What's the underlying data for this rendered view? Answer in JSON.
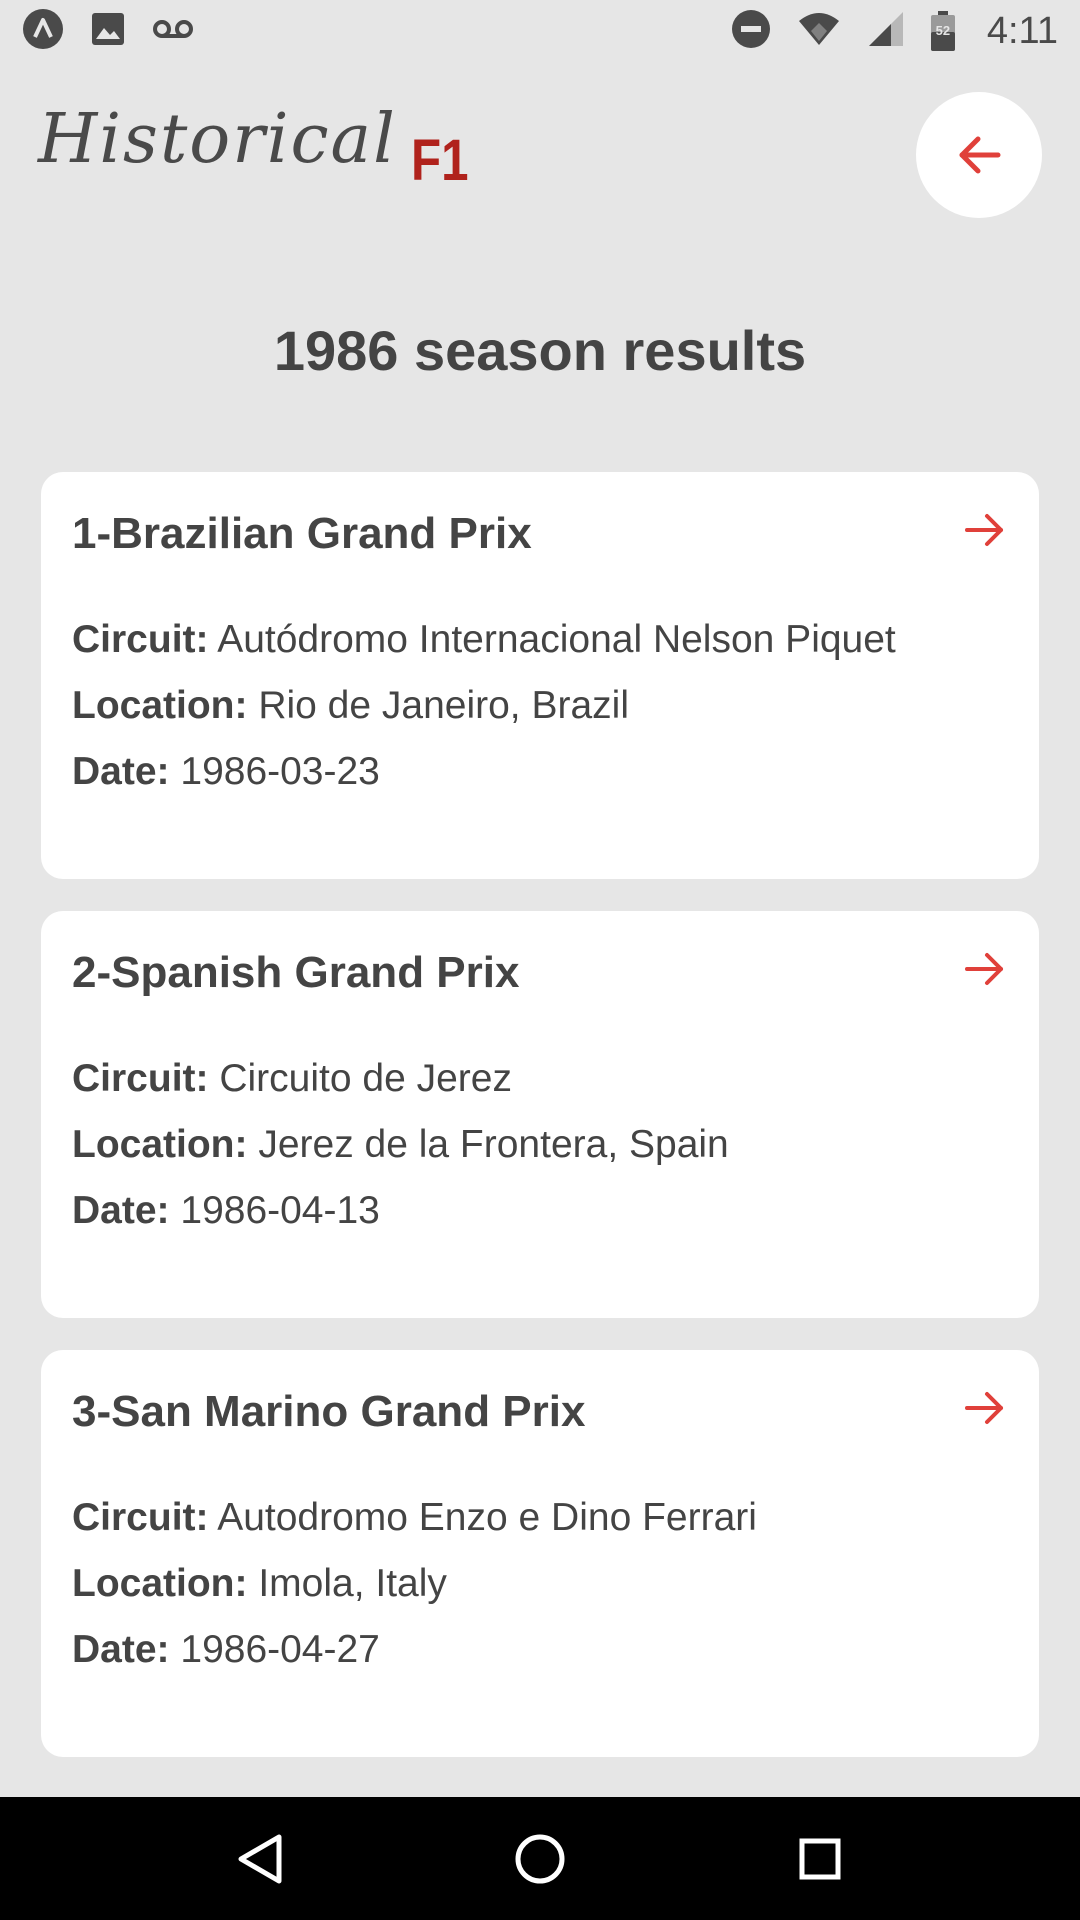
{
  "status_bar": {
    "time": "4:11",
    "battery_level": "52",
    "icons_left": [
      "app-notification-icon",
      "image-icon",
      "voicemail-icon"
    ],
    "icons_right": [
      "do-not-disturb-icon",
      "wifi-icon",
      "signal-icon",
      "battery-icon"
    ]
  },
  "header": {
    "logo_script": "Historical",
    "logo_mark": "F1",
    "back_icon": "arrow-left-icon"
  },
  "page": {
    "title": "1986 season results"
  },
  "labels": {
    "circuit": "Circuit:",
    "location": "Location:",
    "date": "Date:"
  },
  "races": [
    {
      "title": "1-Brazilian Grand Prix",
      "circuit": "Autódromo Internacional Nelson Piquet",
      "location": "Rio de Janeiro, Brazil",
      "date": "1986-03-23"
    },
    {
      "title": "2-Spanish Grand Prix",
      "circuit": "Circuito de Jerez",
      "location": "Jerez de la Frontera, Spain",
      "date": "1986-04-13"
    },
    {
      "title": "3-San Marino Grand Prix",
      "circuit": "Autodromo Enzo e Dino Ferrari",
      "location": "Imola, Italy",
      "date": "1986-04-27"
    }
  ],
  "colors": {
    "accent": "#e0403a",
    "brand_red": "#b0221c",
    "background": "#e6e6e6",
    "card": "#ffffff",
    "text": "#444444"
  },
  "nav_bar": {
    "icons": [
      "back-triangle-icon",
      "home-circle-icon",
      "recents-square-icon"
    ]
  }
}
